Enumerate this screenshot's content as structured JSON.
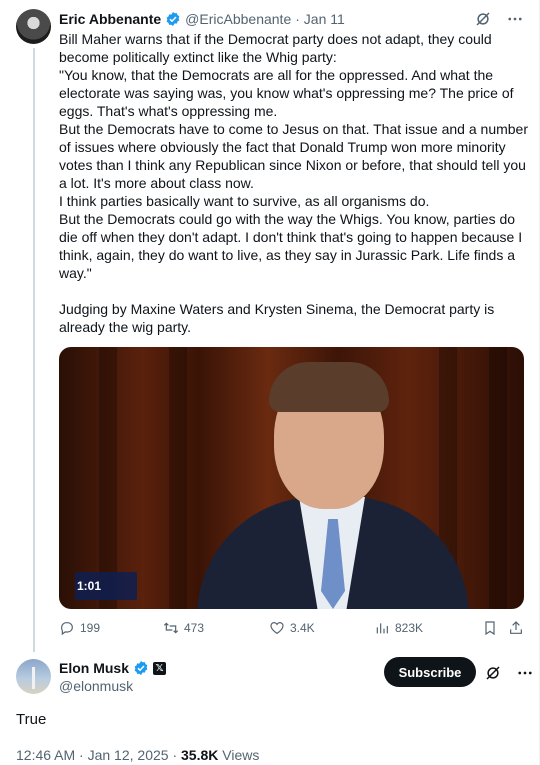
{
  "original_tweet": {
    "author_name": "Eric Abbenante",
    "handle": "@EricAbbenante",
    "date": "· Jan 11",
    "paragraphs": [
      "Bill Maher warns that if the Democrat party does not adapt, they could become politically extinct like the Whig party:",
      "\"You know, that the Democrats are all for the oppressed. And what the electorate was saying was, you know what's oppressing me? The price of eggs. That's what's oppressing me.",
      "But the Democrats have to come to Jesus on that. That issue and a number of issues where obviously the fact that Donald Trump won more minority votes than I think any Republican since Nixon or before, that should tell you a lot. It's more about class now.",
      "I think parties basically want to survive, as all organisms do.",
      "But the Democrats could go with the way the Whigs. You know, parties do die off when they don't adapt. I don't think that's going to happen because I think, again, they do want to live, as they say in Jurassic Park. Life finds a way.\"",
      "Judging by Maxine Waters and Krysten Sinema, the Democrat party is already the wig party."
    ],
    "video": {
      "timestamp": "1:01"
    },
    "stats": {
      "replies": "199",
      "reposts": "473",
      "likes": "3.4K",
      "views": "823K"
    }
  },
  "reply": {
    "author_name": "Elon Musk",
    "handle": "@elonmusk",
    "subscribe_label": "Subscribe",
    "text": "True",
    "timestamp": "12:46 AM · Jan 12, 2025 · ",
    "views_count": "35.8K",
    "views_label": " Views"
  },
  "colors": {
    "verified": "#1d9bf0",
    "text": "#0f1419",
    "muted": "#536471"
  }
}
